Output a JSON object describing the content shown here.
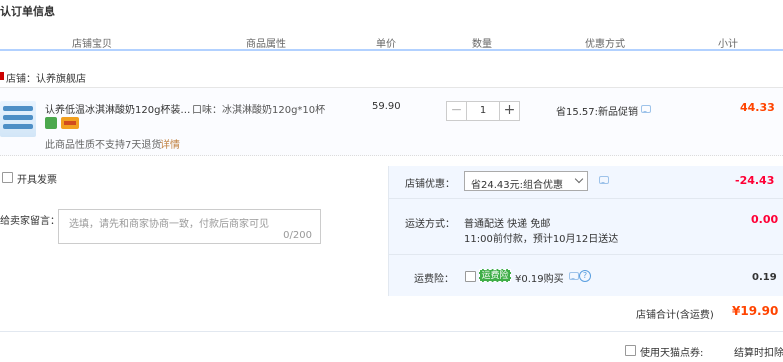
{
  "title": "认订单信息",
  "columns": {
    "shop_product": "店铺宝贝",
    "attributes": "商品属性",
    "unit_price": "单价",
    "quantity": "数量",
    "discount": "优惠方式",
    "subtotal": "小计"
  },
  "shop": {
    "label": "店铺：认养旗舰店"
  },
  "item": {
    "name": "认养低温冰淇淋酸奶120g杯装…",
    "attribute": "口味：冰淇淋酸奶120g*10杯",
    "unit_price": "59.90",
    "quantity": "1",
    "minus": "−",
    "plus": "+",
    "discount": "省15.57:新品促销",
    "subtotal": "44.33",
    "return_notice": "此商品性质不支持7天退货",
    "detail_link": "详情"
  },
  "invoice": {
    "label": "开具发票"
  },
  "seller_note": {
    "label": "给卖家留言：",
    "placeholder": "选填，请先和商家协商一致，付款后商家可见",
    "counter": "0/200"
  },
  "shop_promo": {
    "label": "店铺优惠：",
    "selected": "省24.43元:组合优惠",
    "amount": "-24.43"
  },
  "shipping": {
    "label": "运送方式：",
    "method": "普通配送 快递 免邮",
    "eta": "11:00前付款，预计10月12日送达",
    "fee": "0.00"
  },
  "insurance": {
    "label": "运费险：",
    "tag": "运费险",
    "price": "¥0.19购买",
    "amount": "0.19"
  },
  "shop_total": {
    "label": "店铺合计(含运费)",
    "value": "¥19.90"
  },
  "points": {
    "label": "使用天猫点券:",
    "settle": "结算时扣除"
  },
  "colors": {
    "accent_red": "#ff0036",
    "orange": "#ff4400",
    "header_line": "#b2d1ff",
    "panel_bg": "#f2f7ff"
  }
}
